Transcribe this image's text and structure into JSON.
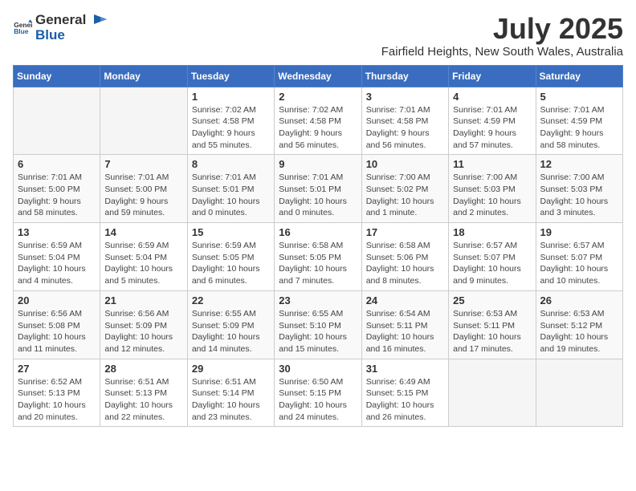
{
  "header": {
    "logo_general": "General",
    "logo_blue": "Blue",
    "month_title": "July 2025",
    "location": "Fairfield Heights, New South Wales, Australia"
  },
  "weekdays": [
    "Sunday",
    "Monday",
    "Tuesday",
    "Wednesday",
    "Thursday",
    "Friday",
    "Saturday"
  ],
  "weeks": [
    [
      {
        "day": "",
        "info": ""
      },
      {
        "day": "",
        "info": ""
      },
      {
        "day": "1",
        "info": "Sunrise: 7:02 AM\nSunset: 4:58 PM\nDaylight: 9 hours and 55 minutes."
      },
      {
        "day": "2",
        "info": "Sunrise: 7:02 AM\nSunset: 4:58 PM\nDaylight: 9 hours and 56 minutes."
      },
      {
        "day": "3",
        "info": "Sunrise: 7:01 AM\nSunset: 4:58 PM\nDaylight: 9 hours and 56 minutes."
      },
      {
        "day": "4",
        "info": "Sunrise: 7:01 AM\nSunset: 4:59 PM\nDaylight: 9 hours and 57 minutes."
      },
      {
        "day": "5",
        "info": "Sunrise: 7:01 AM\nSunset: 4:59 PM\nDaylight: 9 hours and 58 minutes."
      }
    ],
    [
      {
        "day": "6",
        "info": "Sunrise: 7:01 AM\nSunset: 5:00 PM\nDaylight: 9 hours and 58 minutes."
      },
      {
        "day": "7",
        "info": "Sunrise: 7:01 AM\nSunset: 5:00 PM\nDaylight: 9 hours and 59 minutes."
      },
      {
        "day": "8",
        "info": "Sunrise: 7:01 AM\nSunset: 5:01 PM\nDaylight: 10 hours and 0 minutes."
      },
      {
        "day": "9",
        "info": "Sunrise: 7:01 AM\nSunset: 5:01 PM\nDaylight: 10 hours and 0 minutes."
      },
      {
        "day": "10",
        "info": "Sunrise: 7:00 AM\nSunset: 5:02 PM\nDaylight: 10 hours and 1 minute."
      },
      {
        "day": "11",
        "info": "Sunrise: 7:00 AM\nSunset: 5:03 PM\nDaylight: 10 hours and 2 minutes."
      },
      {
        "day": "12",
        "info": "Sunrise: 7:00 AM\nSunset: 5:03 PM\nDaylight: 10 hours and 3 minutes."
      }
    ],
    [
      {
        "day": "13",
        "info": "Sunrise: 6:59 AM\nSunset: 5:04 PM\nDaylight: 10 hours and 4 minutes."
      },
      {
        "day": "14",
        "info": "Sunrise: 6:59 AM\nSunset: 5:04 PM\nDaylight: 10 hours and 5 minutes."
      },
      {
        "day": "15",
        "info": "Sunrise: 6:59 AM\nSunset: 5:05 PM\nDaylight: 10 hours and 6 minutes."
      },
      {
        "day": "16",
        "info": "Sunrise: 6:58 AM\nSunset: 5:05 PM\nDaylight: 10 hours and 7 minutes."
      },
      {
        "day": "17",
        "info": "Sunrise: 6:58 AM\nSunset: 5:06 PM\nDaylight: 10 hours and 8 minutes."
      },
      {
        "day": "18",
        "info": "Sunrise: 6:57 AM\nSunset: 5:07 PM\nDaylight: 10 hours and 9 minutes."
      },
      {
        "day": "19",
        "info": "Sunrise: 6:57 AM\nSunset: 5:07 PM\nDaylight: 10 hours and 10 minutes."
      }
    ],
    [
      {
        "day": "20",
        "info": "Sunrise: 6:56 AM\nSunset: 5:08 PM\nDaylight: 10 hours and 11 minutes."
      },
      {
        "day": "21",
        "info": "Sunrise: 6:56 AM\nSunset: 5:09 PM\nDaylight: 10 hours and 12 minutes."
      },
      {
        "day": "22",
        "info": "Sunrise: 6:55 AM\nSunset: 5:09 PM\nDaylight: 10 hours and 14 minutes."
      },
      {
        "day": "23",
        "info": "Sunrise: 6:55 AM\nSunset: 5:10 PM\nDaylight: 10 hours and 15 minutes."
      },
      {
        "day": "24",
        "info": "Sunrise: 6:54 AM\nSunset: 5:11 PM\nDaylight: 10 hours and 16 minutes."
      },
      {
        "day": "25",
        "info": "Sunrise: 6:53 AM\nSunset: 5:11 PM\nDaylight: 10 hours and 17 minutes."
      },
      {
        "day": "26",
        "info": "Sunrise: 6:53 AM\nSunset: 5:12 PM\nDaylight: 10 hours and 19 minutes."
      }
    ],
    [
      {
        "day": "27",
        "info": "Sunrise: 6:52 AM\nSunset: 5:13 PM\nDaylight: 10 hours and 20 minutes."
      },
      {
        "day": "28",
        "info": "Sunrise: 6:51 AM\nSunset: 5:13 PM\nDaylight: 10 hours and 22 minutes."
      },
      {
        "day": "29",
        "info": "Sunrise: 6:51 AM\nSunset: 5:14 PM\nDaylight: 10 hours and 23 minutes."
      },
      {
        "day": "30",
        "info": "Sunrise: 6:50 AM\nSunset: 5:15 PM\nDaylight: 10 hours and 24 minutes."
      },
      {
        "day": "31",
        "info": "Sunrise: 6:49 AM\nSunset: 5:15 PM\nDaylight: 10 hours and 26 minutes."
      },
      {
        "day": "",
        "info": ""
      },
      {
        "day": "",
        "info": ""
      }
    ]
  ]
}
